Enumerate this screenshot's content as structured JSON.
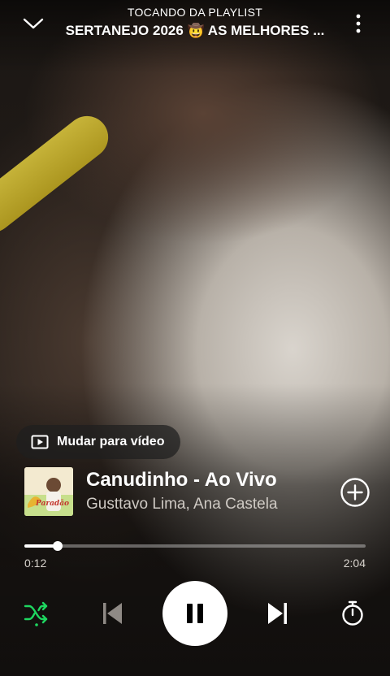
{
  "header": {
    "context_label": "TOCANDO DA PLAYLIST",
    "context_title": "SERTANEJO 2026 🤠 AS MELHORES ..."
  },
  "video_toggle": {
    "label": "Mudar para vídeo"
  },
  "track": {
    "title": "Canudinho - Ao Vivo",
    "artist": "Gusttavo Lima, Ana Castela",
    "is_saved": false,
    "cover_text": "Paradão"
  },
  "playback": {
    "elapsed": "0:12",
    "duration": "2:04",
    "progress_fraction": 0.097,
    "is_playing": true,
    "shuffle_enabled": true
  },
  "colors": {
    "accent_green": "#1ed760",
    "text_primary": "#ffffff",
    "text_secondary": "#cfcac4"
  },
  "icons": {
    "collapse": "chevron-down-icon",
    "more": "more-vertical-icon",
    "video": "video-play-icon",
    "add": "plus-circle-icon",
    "shuffle": "shuffle-icon",
    "previous": "skip-previous-icon",
    "pause": "pause-icon",
    "next": "skip-next-icon",
    "timer": "sleep-timer-icon"
  }
}
